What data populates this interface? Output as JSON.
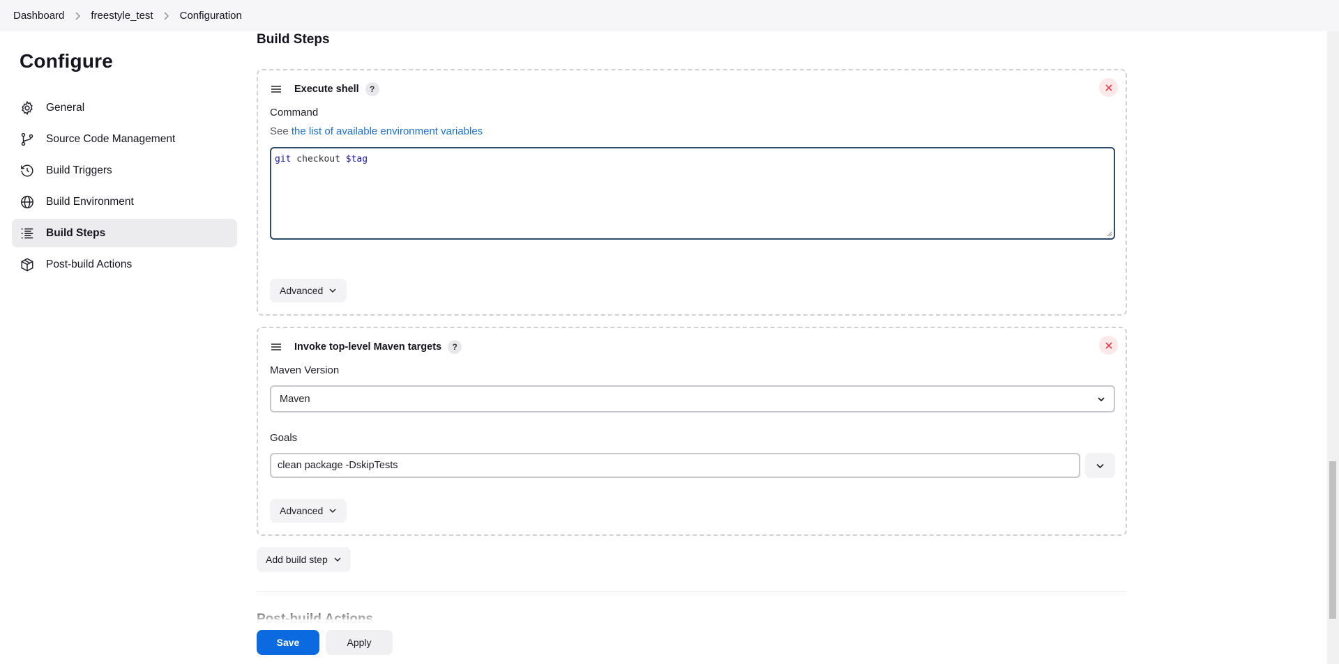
{
  "breadcrumb": {
    "items": [
      "Dashboard",
      "freestyle_test",
      "Configuration"
    ]
  },
  "sidebar": {
    "title": "Configure",
    "items": [
      {
        "label": "General",
        "icon": "gear-icon"
      },
      {
        "label": "Source Code Management",
        "icon": "branch-icon"
      },
      {
        "label": "Build Triggers",
        "icon": "clock-icon"
      },
      {
        "label": "Build Environment",
        "icon": "globe-icon"
      },
      {
        "label": "Build Steps",
        "icon": "list-icon",
        "active": true
      },
      {
        "label": "Post-build Actions",
        "icon": "package-icon"
      }
    ]
  },
  "main": {
    "section_title": "Build Steps",
    "execute_shell": {
      "title": "Execute shell",
      "help": "?",
      "command_label": "Command",
      "desc_prefix": "See ",
      "desc_link": "the list of available environment variables",
      "command": {
        "kw": "git",
        "plain": " checkout ",
        "var": "$tag"
      },
      "advanced_label": "Advanced"
    },
    "maven": {
      "title": "Invoke top-level Maven targets",
      "help": "?",
      "version_label": "Maven Version",
      "version_value": "Maven",
      "goals_label": "Goals",
      "goals_value": "clean package -DskipTests",
      "advanced_label": "Advanced"
    },
    "add_build_step": "Add build step",
    "next_section": "Post-build Actions"
  },
  "footer": {
    "save": "Save",
    "apply": "Apply"
  },
  "colors": {
    "accent": "#0b6adf",
    "link": "#1a6fd6",
    "danger": "#e33b46"
  }
}
